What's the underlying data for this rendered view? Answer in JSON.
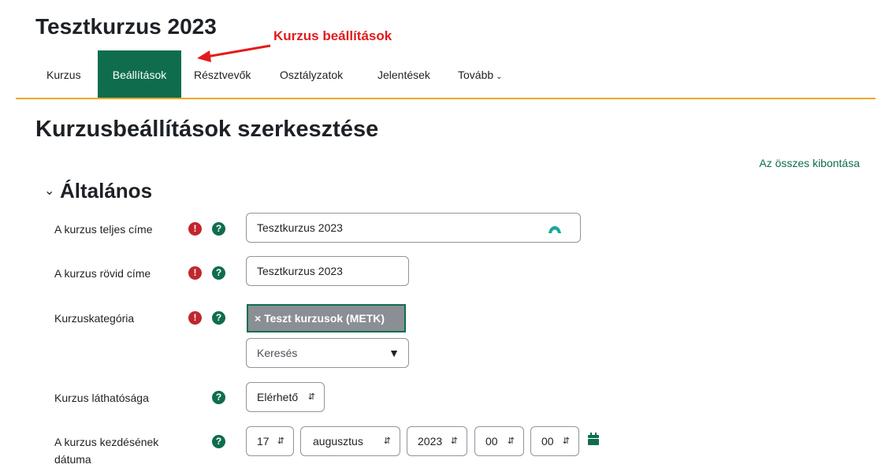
{
  "course": {
    "title": "Tesztkurzus 2023"
  },
  "annotation": {
    "text": "Kurzus beállítások"
  },
  "nav": {
    "items": [
      {
        "label": "Kurzus"
      },
      {
        "label": "Beállítások"
      },
      {
        "label": "Résztvevők"
      },
      {
        "label": "Osztályzatok"
      },
      {
        "label": "Jelentések"
      },
      {
        "label": "Tovább"
      }
    ]
  },
  "page": {
    "title": "Kurzusbeállítások szerkesztése",
    "expand_all": "Az összes kibontása"
  },
  "section": {
    "title": "Általános"
  },
  "form": {
    "fullname": {
      "label": "A kurzus teljes címe",
      "value": "Tesztkurzus 2023"
    },
    "shortname": {
      "label": "A kurzus rövid címe",
      "value": "Tesztkurzus 2023"
    },
    "category": {
      "label": "Kurzuskategória",
      "selected": "× Teszt kurzusok (METK)",
      "search_placeholder": "Keresés"
    },
    "visibility": {
      "label": "Kurzus láthatósága",
      "value": "Elérhető"
    },
    "startdate": {
      "label_line1": "A kurzus kezdésének",
      "label_line2": "dátuma",
      "day": "17",
      "month": "augusztus",
      "year": "2023",
      "hour": "00",
      "minute": "00"
    }
  },
  "icons": {
    "required": "!",
    "help": "?"
  },
  "colors": {
    "accent": "#0f6d4e",
    "nav_border": "#f0a821",
    "required": "#c1272d",
    "annotation": "#e31b1b"
  }
}
